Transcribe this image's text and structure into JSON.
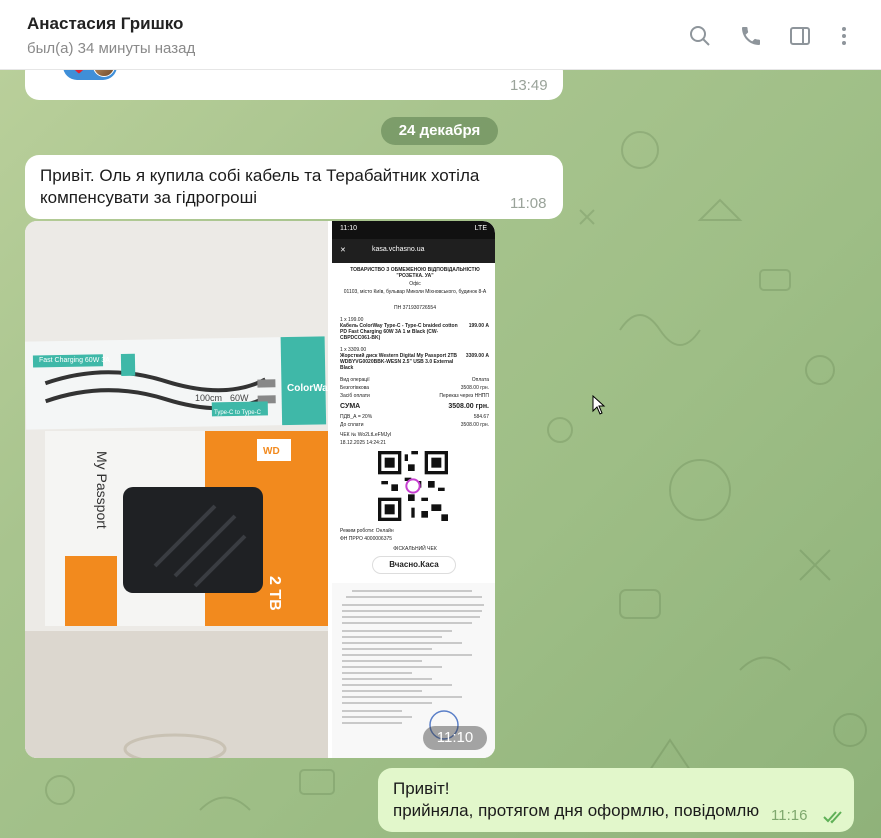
{
  "header": {
    "contact_name": "Анастасия Гришко",
    "status": "был(а) 34 минуты назад",
    "icons": [
      "search-icon",
      "phone-icon",
      "sidebar-toggle-icon",
      "more-vert-icon"
    ]
  },
  "messages": {
    "prev": {
      "time": "13:49",
      "reaction": "❤️"
    },
    "date_divider": "24 декабря",
    "msg1": {
      "text": "Привіт. Оль я купила собі кабель та Терабайтник хотіла компенсувати за гідрогроші",
      "time": "11:08"
    },
    "album": {
      "time": "11:10",
      "photo1": {
        "cable_brand": "ColorWay",
        "cable_label": "Fast Charging 60W 3A",
        "cable_type": "Type-C to Type-C",
        "cable_wattage": "60W",
        "cable_length": "100cm",
        "drive_brand": "WD",
        "drive_model": "My Passport",
        "drive_capacity": "2 TB"
      },
      "receipt": {
        "phone_time": "11:10",
        "phone_status": "LTE",
        "url": "kasa.vchasno.ua",
        "company": "ТОВАРИСТВО З ОБМЕЖЕНОЮ ВІДПОВІДАЛЬНІСТЮ \"РОЗЕТКА. УА\"",
        "office": "Офіс",
        "address": "01103, місто Київ, бульвар Миколи Міхновського, будинок 8-А",
        "pn": "ПН 371930726554",
        "item1_qty": "1 x 199.00",
        "item1_name": "Кабель ColorWay Type-C - Type-C braided cotton PD Fast Charging 60W 3A 1 м Black (CW-CBPDCC061-BK)",
        "item1_sum": "199.00 А",
        "item2_qty": "1 x 3309.00",
        "item2_name": "Жорсткий диск Western Digital My Passport 2TB WDBYVG0020BBK-WESN 2.5\" USB 3.0 External Black",
        "item2_sum": "3309.00 А",
        "op_label": "Вид операції",
        "op_value": "Оплата",
        "cashless_label": "Безготівкова",
        "cashless_value": "3508.00 грн.",
        "pay_label": "Засіб оплати",
        "pay_value": "Переказ через ННПП",
        "total_label": "СУМА",
        "total_value": "3508.00 грн.",
        "vat_label": "ПДВ_А = 20%",
        "vat_value": "584.67",
        "topay_label": "До сплати",
        "topay_value": "3508.00 грн.",
        "check_no": "ЧЕК № Wo2LtLeFMJyI",
        "datetime": "18.12.2025 14:24:21",
        "mode": "Режим роботи: Онлайн",
        "fn": "ФН ПРРО 4000006375",
        "fiscal": "ФІСКАЛЬНИЙ ЧЕК",
        "brand": "Вчасно.Каса"
      }
    },
    "msg_out": {
      "line1": "Привіт!",
      "line2": "прийняла, протягом дня оформлю, повідомлю",
      "time": "11:16"
    }
  },
  "colors": {
    "chat_bg": "#9fbf88",
    "bubble_in": "#ffffff",
    "bubble_out": "#e2f7cb",
    "date_pill": "#6e8f5e",
    "check": "#5fb057"
  }
}
